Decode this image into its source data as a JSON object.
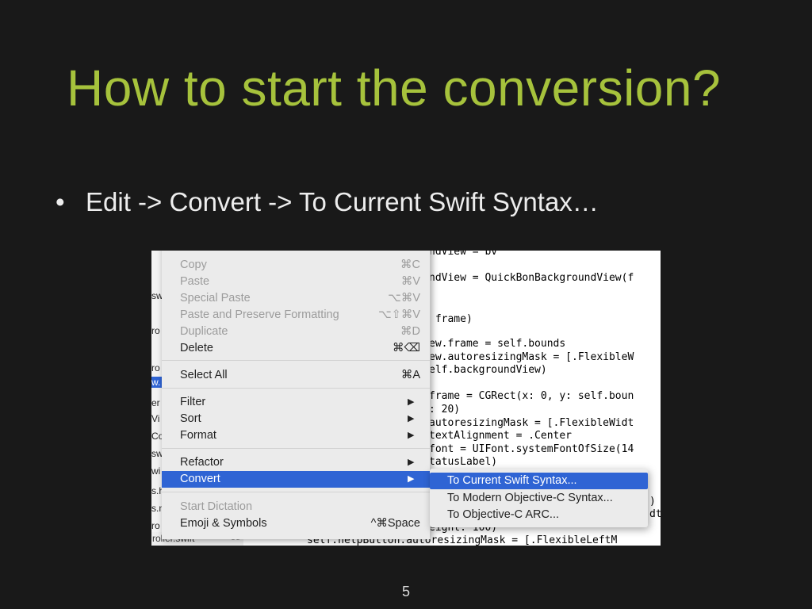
{
  "slide": {
    "title": "How to start the conversion?",
    "bullet_marker": "•",
    "bullet_text": "Edit -> Convert -> To Current Swift Syntax…",
    "page_number": "5"
  },
  "colors": {
    "background": "#191919",
    "title": "#a6c23c",
    "highlight": "#2f64d4"
  },
  "navigator": {
    "fragments": [
      "sw",
      "ro",
      "ro",
      "w.",
      "er",
      "Vi",
      "Co",
      "sw",
      "wi",
      "s.h",
      "s.m",
      "ro"
    ],
    "selected_index": 3,
    "bottom_file": "roller.swift",
    "bottom_line": "55"
  },
  "edit_menu": {
    "items": [
      {
        "label": "Copy",
        "shortcut": "⌘C",
        "enabled": false
      },
      {
        "label": "Paste",
        "shortcut": "⌘V",
        "enabled": false
      },
      {
        "label": "Special Paste",
        "shortcut": "⌥⌘V",
        "enabled": false
      },
      {
        "label": "Paste and Preserve Formatting",
        "shortcut": "⌥⇧⌘V",
        "enabled": false
      },
      {
        "label": "Duplicate",
        "shortcut": "⌘D",
        "enabled": false
      },
      {
        "label": "Delete",
        "shortcut": "⌘⌫",
        "enabled": true
      },
      {
        "label": "Select All",
        "shortcut": "⌘A",
        "enabled": true
      },
      {
        "label": "Filter",
        "submenu": true,
        "enabled": true
      },
      {
        "label": "Sort",
        "submenu": true,
        "enabled": true
      },
      {
        "label": "Format",
        "submenu": true,
        "enabled": true
      },
      {
        "label": "Refactor",
        "submenu": true,
        "enabled": true
      },
      {
        "label": "Convert",
        "submenu": true,
        "enabled": true,
        "highlighted": true
      },
      {
        "label": "Start Dictation",
        "shortcut": "",
        "enabled": false
      },
      {
        "label": "Emoji & Symbols",
        "shortcut": "^⌘Space",
        "enabled": true
      }
    ],
    "submenu_arrow": "▶"
  },
  "convert_submenu": {
    "items": [
      {
        "label": "To Current Swift Syntax...",
        "highlighted": true
      },
      {
        "label": "To Modern Objective-C Syntax..."
      },
      {
        "label": "To Objective-C ARC..."
      }
    ]
  },
  "code_fragments": [
    "ndView = bv",
    "ndView = QuickBonBackgroundView(f",
    " frame)",
    "ew.frame = self.bounds",
    "ew.autoresizingMask = [.FlexibleW",
    "elf.backgroundView)",
    "frame = CGRect(x: 0, y: self.boun",
    ": 20)",
    "autoresizingMask = [.FlexibleWidt",
    "textAlignment = .Center",
    "font = UIFont.systemFontOfSize(14",
    "tatusLabel)",
    ")",
    "dt",
    "eight: 100)",
    "self.helpButton.autoresizingMask = [.FlexibleLeftM"
  ]
}
